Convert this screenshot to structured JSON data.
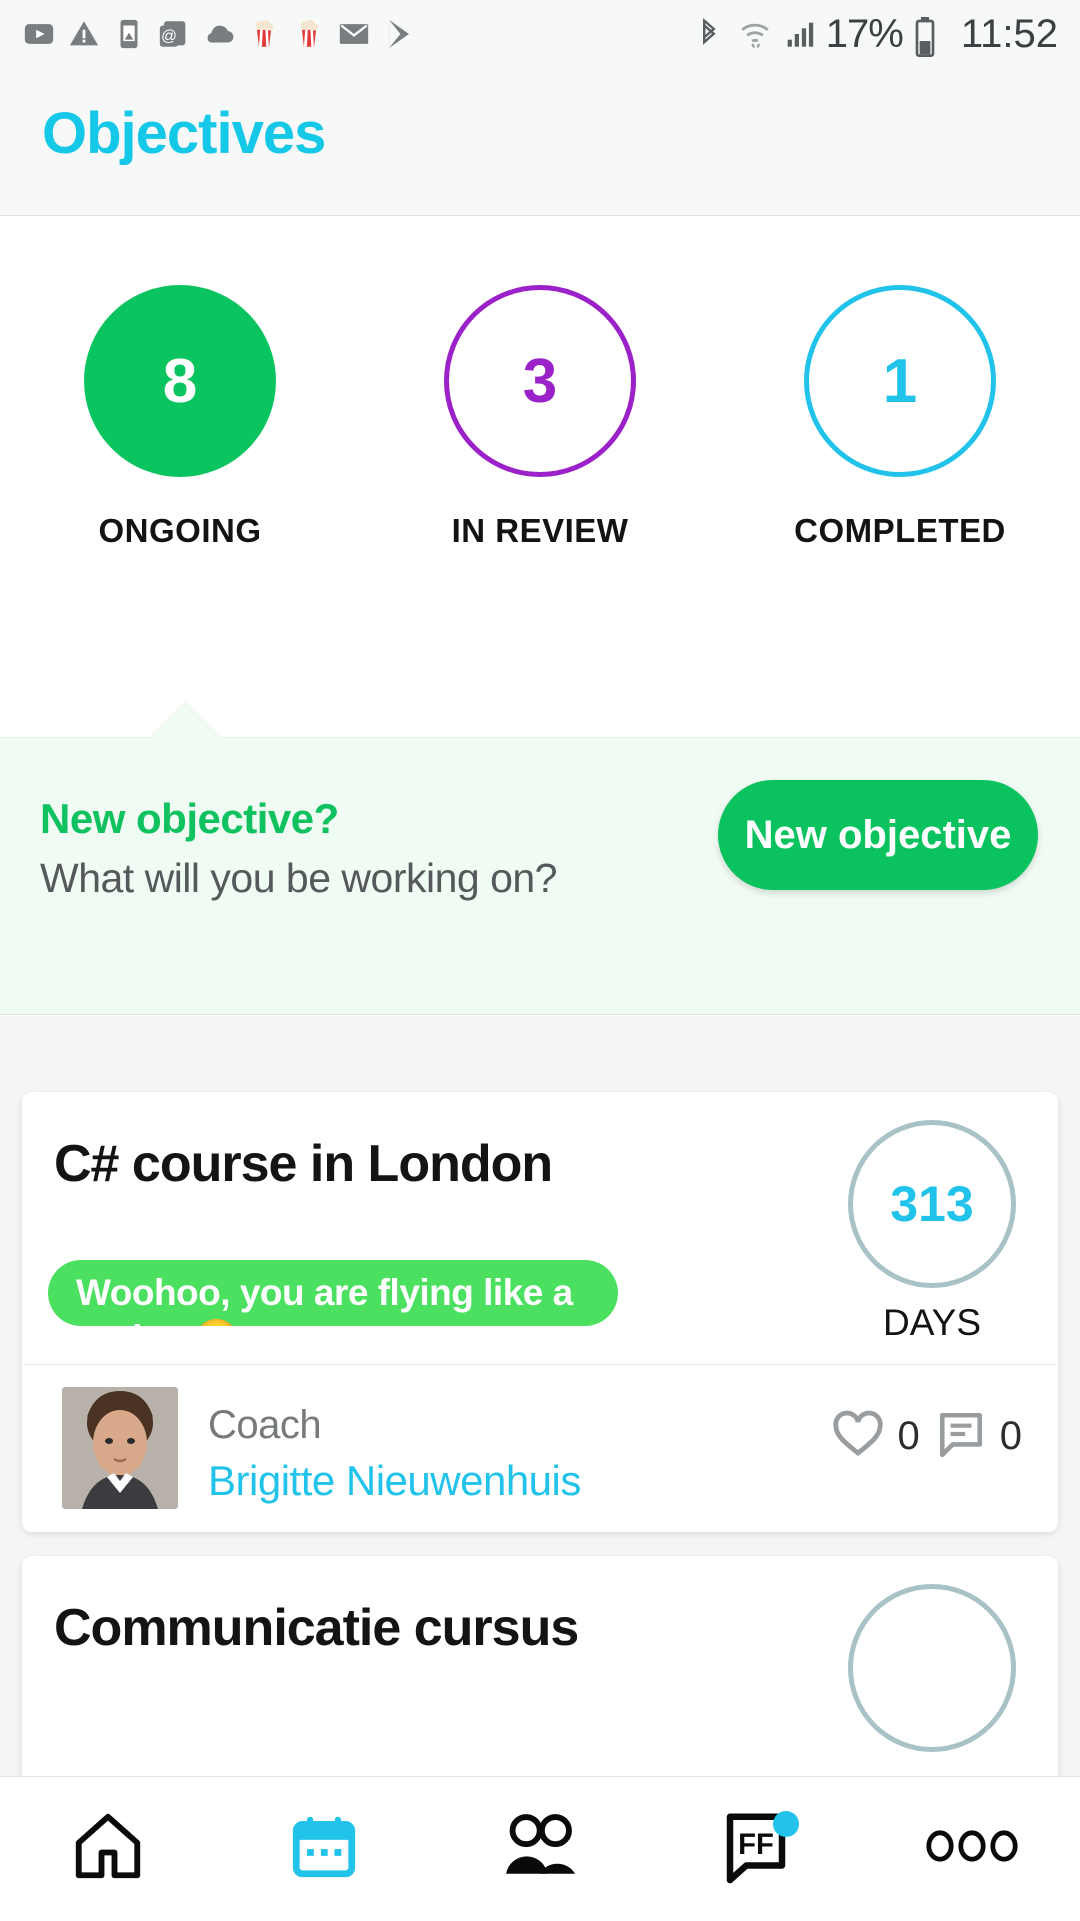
{
  "statusbar": {
    "left_icons": [
      "youtube-icon",
      "warning-icon",
      "photo-device-icon",
      "email-at-icon",
      "cloud-icon",
      "popcorn-icon",
      "popcorn-icon",
      "mail-icon",
      "play-store-icon"
    ],
    "bluetooth_icon": "bluetooth-icon",
    "wifi_icon": "wifi-icon",
    "signal_icon": "cellular-signal-icon",
    "battery_percent": "17%",
    "battery_icon": "battery-icon",
    "time": "11:52"
  },
  "header": {
    "title": "Objectives"
  },
  "stats": [
    {
      "count": "8",
      "label": "ONGOING",
      "style": "fill-green",
      "color": "#0ac460",
      "selected": true
    },
    {
      "count": "3",
      "label": "IN REVIEW",
      "style": "out-purple",
      "color": "#9b22c9",
      "selected": false
    },
    {
      "count": "1",
      "label": "COMPLETED",
      "style": "out-cyan",
      "color": "#22c3ea",
      "selected": false
    }
  ],
  "banner": {
    "title": "New objective?",
    "subtitle": "What will you be working on?",
    "button_label": "New objective",
    "background": "#effbf3",
    "accent": "#0ac25e"
  },
  "cards": [
    {
      "title": "C# course in London",
      "days_value": "313",
      "days_label": "DAYS",
      "pill_text": "Woohoo, you are flying like a rocket 😂",
      "pill_color": "#4be05f",
      "coach_role": "Coach",
      "coach_name": "Brigitte Nieuwenhuis",
      "likes": "0",
      "comments": "0",
      "like_icon": "heart-icon",
      "comment_icon": "comment-icon",
      "avatar": "coach-avatar"
    },
    {
      "title": "Communicatie cursus",
      "days_value": "",
      "days_label": "",
      "pill_text": "",
      "pill_color": "",
      "coach_role": "",
      "coach_name": "",
      "likes": "",
      "comments": "",
      "like_icon": "",
      "comment_icon": "",
      "avatar": ""
    }
  ],
  "bottomnav": [
    {
      "name": "home-icon",
      "label": "",
      "active": false
    },
    {
      "name": "calendar-icon",
      "label": "",
      "active": true
    },
    {
      "name": "people-icon",
      "label": "",
      "active": false
    },
    {
      "name": "feedback-ff-icon",
      "label": "FF",
      "active": false,
      "badge": true
    },
    {
      "name": "more-dots-icon",
      "label": "",
      "active": false
    }
  ]
}
